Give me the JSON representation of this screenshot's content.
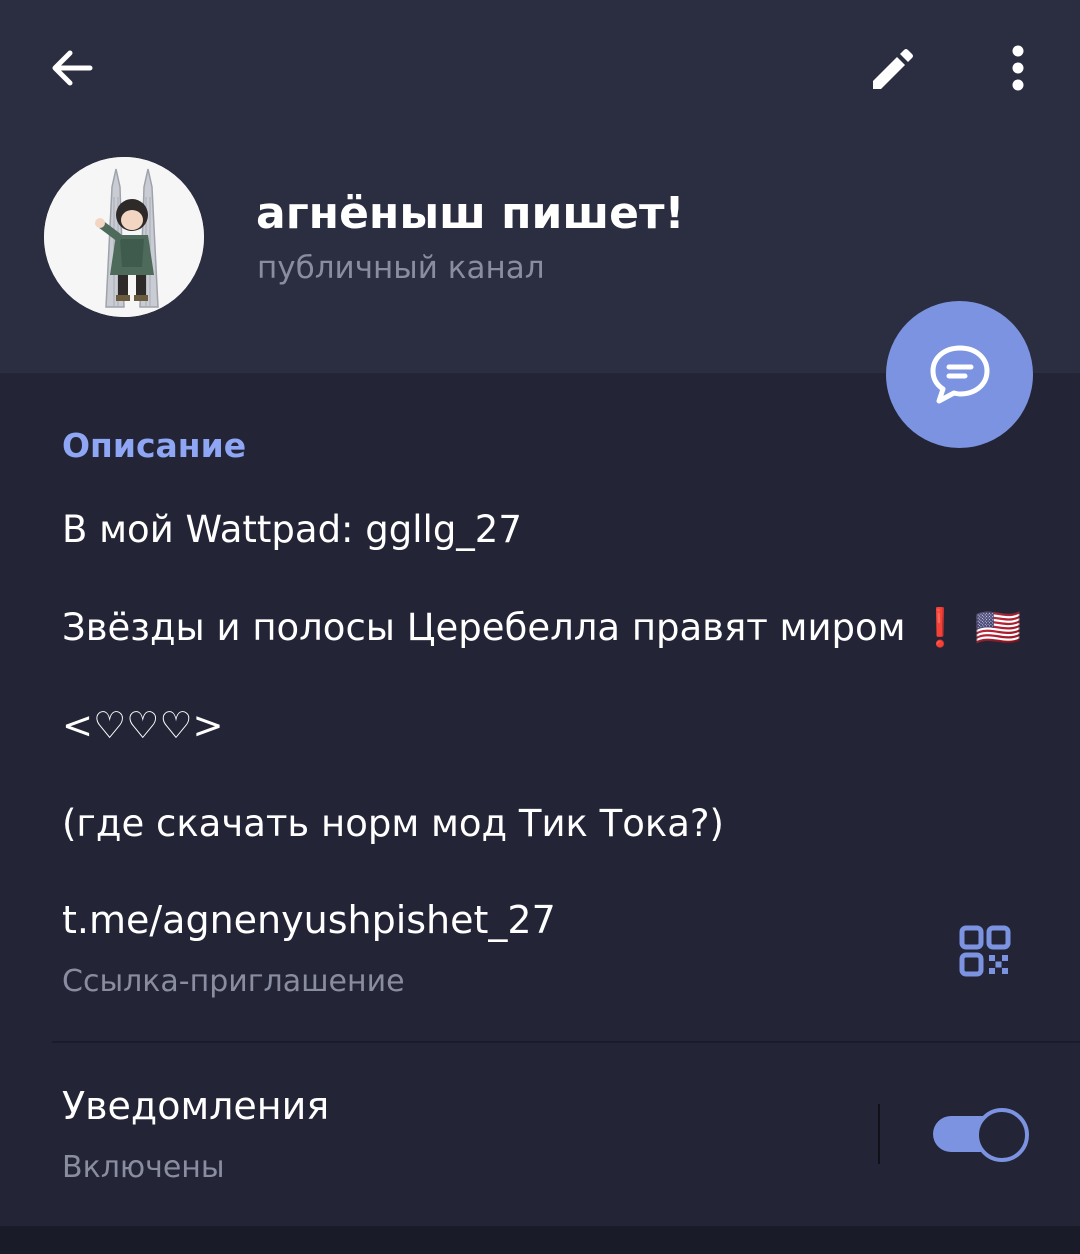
{
  "header": {
    "back_icon": "arrow-left-icon",
    "edit_icon": "pencil-icon",
    "more_icon": "more-vertical-icon"
  },
  "channel": {
    "title": "агнёныш пишет!",
    "subtitle": "публичный канал",
    "avatar_icon": "channel-avatar"
  },
  "fab": {
    "icon": "chat-bubble-icon"
  },
  "description": {
    "label": "Описание",
    "lines": [
      "В мой Wattpad: ggllg_27",
      "Звёзды и полосы Церебелла правят миром ❗ 🇺🇸",
      "<♡♡♡>",
      "(где скачать норм мод Тик Тока?)"
    ]
  },
  "invite": {
    "link": "t.me/agnenyushpishet_27",
    "caption": "Ссылка-приглашение",
    "qr_icon": "qr-code-icon"
  },
  "notifications": {
    "title": "Уведомления",
    "status": "Включены",
    "enabled": true
  },
  "colors": {
    "accent": "#7b93e0",
    "label_accent": "#8ea6f3",
    "header_bg": "#2b2d40",
    "body_bg": "#232537",
    "secondary_text": "#8a8d9f"
  }
}
